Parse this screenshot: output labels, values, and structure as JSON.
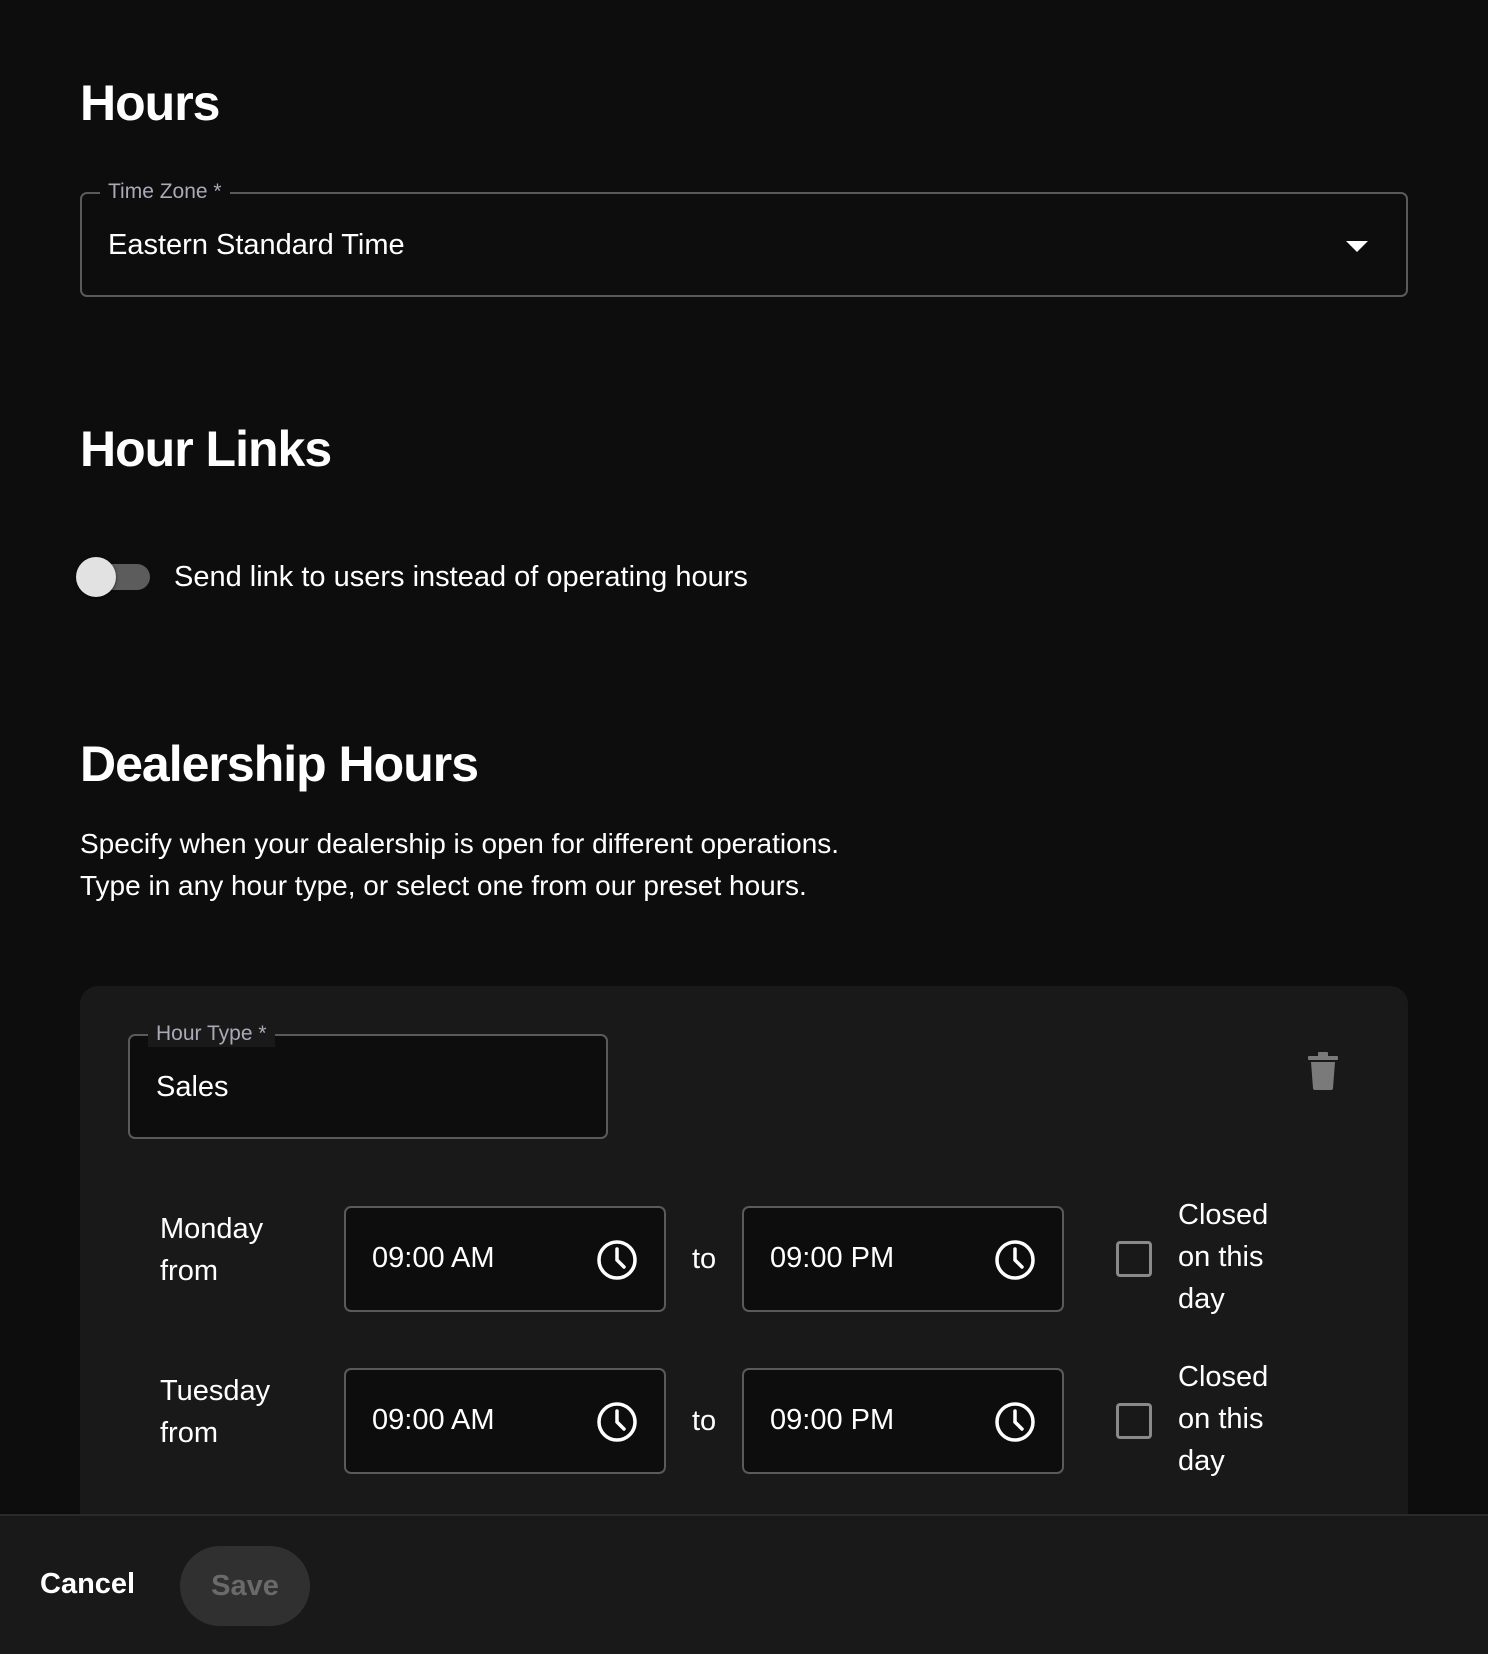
{
  "hours": {
    "title": "Hours",
    "time_zone": {
      "label": "Time Zone *",
      "value": "Eastern Standard Time"
    }
  },
  "hour_links": {
    "title": "Hour Links",
    "toggle_label": "Send link to users instead of operating hours",
    "toggle_on": false
  },
  "dealership_hours": {
    "title": "Dealership Hours",
    "description_lines": [
      "Specify when your dealership is open for different operations.",
      "Type in any hour type, or select one from our preset hours."
    ],
    "hour_type": {
      "label": "Hour Type *",
      "value": "Sales"
    },
    "days": [
      {
        "day_line1": "Monday",
        "day_line2": "from",
        "from": "09:00 AM",
        "to_label": "to",
        "to": "09:00 PM",
        "closed_label_lines": [
          "Closed",
          "on this",
          "day"
        ],
        "closed": false
      },
      {
        "day_line1": "Tuesday",
        "day_line2": "from",
        "from": "09:00 AM",
        "to_label": "to",
        "to": "09:00 PM",
        "closed_label_lines": [
          "Closed",
          "on this",
          "day"
        ],
        "closed": false
      }
    ]
  },
  "footer": {
    "cancel_label": "Cancel",
    "save_label": "Save",
    "save_enabled": false
  },
  "icons": {
    "caret": "chevron-down-icon",
    "trash": "trash-icon",
    "clock": "clock-icon"
  },
  "colors": {
    "background": "#0d0d0d",
    "card": "#191919",
    "border": "#5a5a5a",
    "legend": "#a9a9b8",
    "save_disabled_bg": "#303030",
    "save_disabled_text": "#6a6a6a"
  }
}
